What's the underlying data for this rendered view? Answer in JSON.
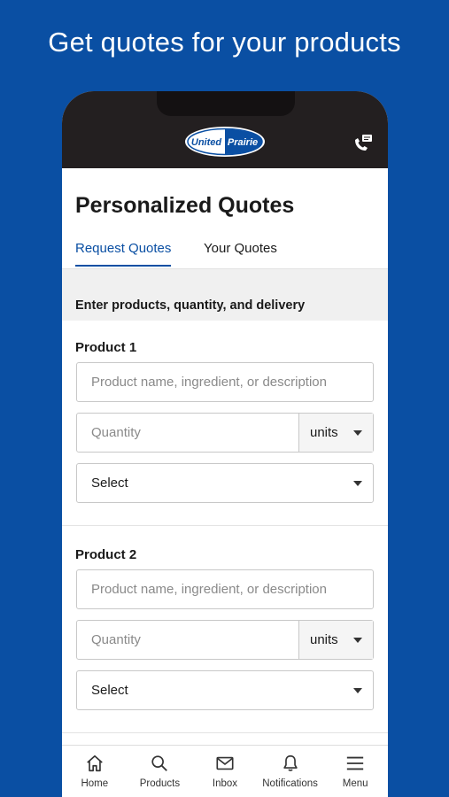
{
  "promo": {
    "title": "Get quotes for your products"
  },
  "header": {
    "logo": {
      "word1": "United",
      "word2": "Prairie"
    },
    "icons": {
      "right": "phone-message-icon"
    }
  },
  "page": {
    "title": "Personalized Quotes",
    "tabs": [
      {
        "label": "Request Quotes",
        "active": true
      },
      {
        "label": "Your Quotes",
        "active": false
      }
    ],
    "section_label": "Enter products, quantity, and delivery"
  },
  "products": [
    {
      "label": "Product 1",
      "name_placeholder": "Product name, ingredient, or description",
      "quantity_placeholder": "Quantity",
      "unit_value": "units",
      "delivery_value": "Select"
    },
    {
      "label": "Product 2",
      "name_placeholder": "Product name, ingredient, or description",
      "quantity_placeholder": "Quantity",
      "unit_value": "units",
      "delivery_value": "Select"
    }
  ],
  "bottom_nav": [
    {
      "label": "Home",
      "icon": "home-icon"
    },
    {
      "label": "Products",
      "icon": "search-icon"
    },
    {
      "label": "Inbox",
      "icon": "mail-icon"
    },
    {
      "label": "Notifications",
      "icon": "bell-icon"
    },
    {
      "label": "Menu",
      "icon": "menu-icon"
    }
  ],
  "colors": {
    "brand_blue": "#0a4fa3",
    "header_dark": "#231f20",
    "section_gray": "#f0f0f0"
  }
}
